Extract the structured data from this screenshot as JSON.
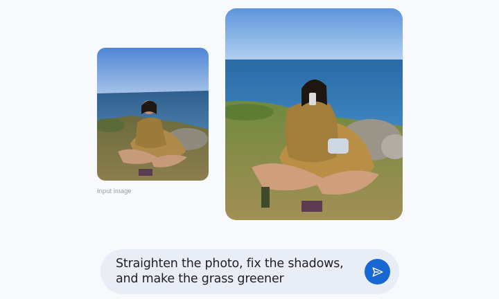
{
  "input_image": {
    "caption": "Input image",
    "icon": "photo-input"
  },
  "output_image": {
    "icon": "photo-output"
  },
  "prompt": {
    "line1": "Straighten the photo, fix the shadows,",
    "line2": "and make the grass greener",
    "send_icon": "send-icon"
  },
  "colors": {
    "background": "#f8f9fc",
    "prompt_bg": "#e8edf6",
    "accent": "#1967d2",
    "caption": "#9aa0a6"
  }
}
